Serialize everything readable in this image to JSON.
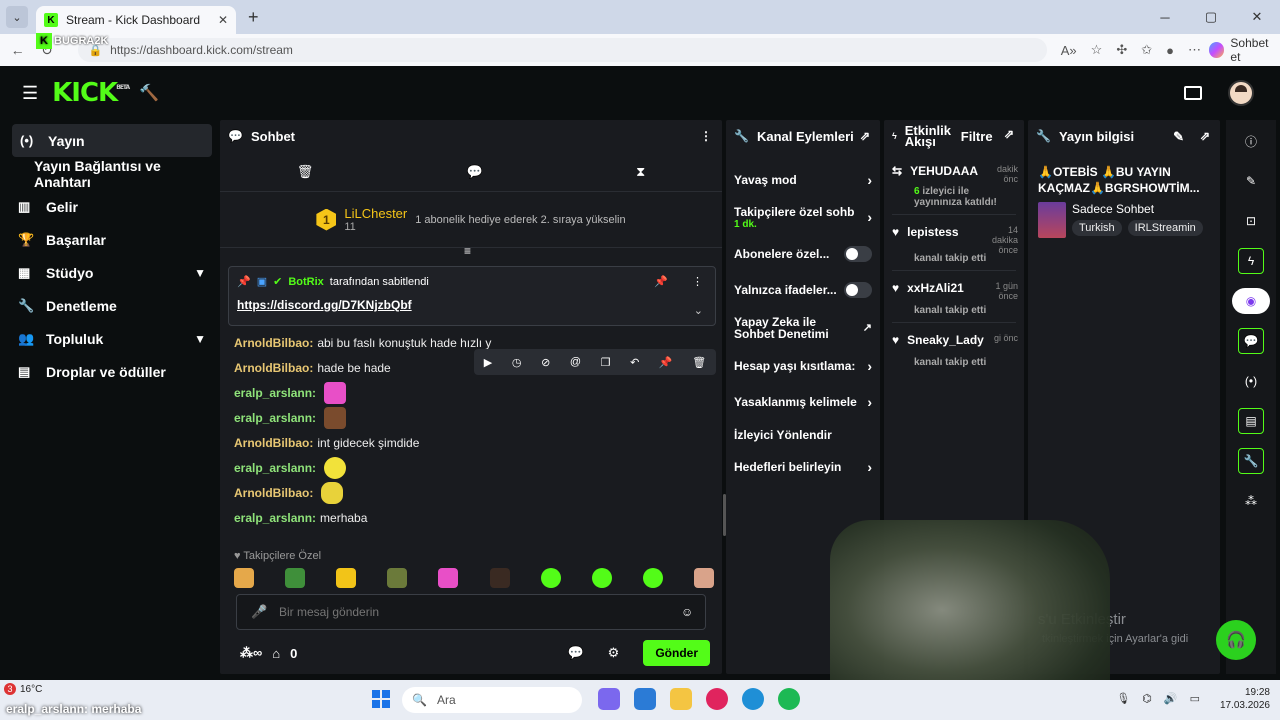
{
  "browser": {
    "tab_title": "Stream - Kick Dashboard",
    "tab_close": "✕",
    "new_tab": "+",
    "url": "https://dashboard.kick.com/stream",
    "copilot_label": "Sohbet et",
    "min": "─",
    "max": "▢",
    "close": "✕"
  },
  "watermark": {
    "text": "BUGRA2K"
  },
  "topbar": {
    "logo": "KICK",
    "logo_badge": "BETA"
  },
  "sidebar": {
    "items": [
      {
        "label": "Yayın",
        "icon": "(•)"
      },
      {
        "label": "Yayın Bağlantısı ve Anahtarı"
      },
      {
        "label": "Gelir",
        "icon": "▥"
      },
      {
        "label": "Başarılar",
        "icon": "🏆"
      },
      {
        "label": "Stüdyo",
        "icon": "▦"
      },
      {
        "label": "Denetleme",
        "icon": "🔧"
      },
      {
        "label": "Topluluk",
        "icon": "👥"
      },
      {
        "label": "Droplar ve ödüller",
        "icon": "▤"
      }
    ]
  },
  "chat": {
    "title": "Sohbet",
    "sub_rank": "1",
    "sub_user": "LiLChester",
    "sub_count": "11",
    "sub_text": "1 abonelik hediye ederek 2. sıraya yükselin",
    "pinned_by": "BotRix",
    "pinned_suffix": "tarafından sabitlendi",
    "pinned_link": "https://discord.gg/D7KNjzbQbf",
    "messages": [
      {
        "user": "ArnoldBilbao:",
        "text": "abi bu faslı konuştuk hade hızlı y"
      },
      {
        "user": "ArnoldBilbao:",
        "text": "hade be hade"
      },
      {
        "user": "eralp_arslann:",
        "text": ""
      },
      {
        "user": "eralp_arslann:",
        "text": ""
      },
      {
        "user": "ArnoldBilbao:",
        "text": "int gidecek şimdide"
      },
      {
        "user": "eralp_arslann:",
        "text": ""
      },
      {
        "user": "ArnoldBilbao:",
        "text": ""
      },
      {
        "user": "eralp_arslann:",
        "text": "merhaba"
      }
    ],
    "tray_label": "♥ Takipçilere Özel",
    "input_placeholder": "Bir mesaj gönderin",
    "footer_count": "0",
    "send": "Gönder"
  },
  "kanal": {
    "title": "Kanal Eylemleri",
    "actions": [
      {
        "label": "Yavaş mod"
      },
      {
        "label": "Takipçilere özel sohb",
        "tag": "1 dk."
      },
      {
        "label": "Abonelere özel..."
      },
      {
        "label": "Yalnızca ifadeler..."
      },
      {
        "label": "Yapay Zeka ile Sohbet Denetimi"
      },
      {
        "label": "Hesap yaşı kısıtlama:"
      },
      {
        "label": "Yasaklanmış kelimele"
      },
      {
        "label": "İzleyici Yönlendir"
      },
      {
        "label": "Hedefleri belirleyin"
      }
    ]
  },
  "akis": {
    "title": "Etkinlik Akışı",
    "filter": "Filtre",
    "events": [
      {
        "user": "YEHUDAAA",
        "time": "dakik önc",
        "count": "6",
        "desc": "izleyici ile yayınınıza katıldı!"
      },
      {
        "user": "lepistess",
        "time": "14 dakika önce",
        "desc": "kanalı takip etti"
      },
      {
        "user": "xxHzAli21",
        "time": "1 gün önce",
        "desc": "kanalı takip etti"
      },
      {
        "user": "Sneaky_Lady",
        "time": "gi önc",
        "desc": "kanalı takip etti"
      }
    ]
  },
  "bilgi": {
    "title": "Yayın bilgisi",
    "stream_title": "🙏OTEBİS 🙏BU YAYIN KAÇMAZ🙏BGRSHOWTİM...",
    "category": "Sadece Sohbet",
    "tags": [
      "Turkish",
      "IRLStreamin"
    ]
  },
  "ghost_text": {
    "line1": "s'u Etkinleştir",
    "line2": "tkinleştirmek için Ayarlar'a gidi"
  },
  "taskbar": {
    "weather_temp": "16°C",
    "weather_count": "3",
    "overlay_message": "eralp_arslann: merhaba",
    "search": "Ara",
    "time": "19:28",
    "date": "17.03.2026"
  },
  "colors": {
    "accent": "#53fc18",
    "bg": "#0b0e0f",
    "panel": "#191b1f"
  }
}
